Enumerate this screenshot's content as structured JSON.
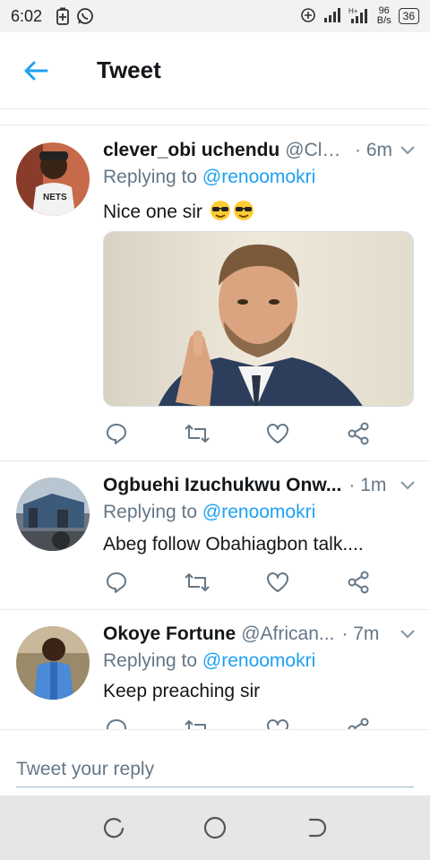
{
  "status_bar": {
    "time": "6:02",
    "network_speed_value": "96",
    "network_speed_unit": "B/s",
    "battery": "36"
  },
  "header": {
    "title": "Tweet"
  },
  "tweets": [
    {
      "name": "clever_obi uchendu",
      "handle": "@Cle...",
      "time": "· 6m",
      "replying_prefix": "Replying to ",
      "replying_to": "@renoomokri",
      "text": "Nice one sir",
      "emojis": [
        "sunglasses-emoji",
        "sunglasses-emoji"
      ]
    },
    {
      "name": "Ogbuehi Izuchukwu Onw...",
      "handle": "",
      "time": "· 1m",
      "replying_prefix": "Replying to ",
      "replying_to": "@renoomokri",
      "text": "Abeg follow Obahiagbon talk...."
    },
    {
      "name": "Okoye Fortune",
      "handle": "@African...",
      "time": "· 7m",
      "replying_prefix": "Replying to ",
      "replying_to": "@renoomokri",
      "text": "Keep preaching sir"
    }
  ],
  "reply_bar": {
    "placeholder": "Tweet your reply"
  },
  "colors": {
    "accent": "#1da1f2",
    "secondary_text": "#657786",
    "primary_text": "#14171a",
    "divider": "#e6ecf0"
  },
  "icons": {
    "back": "arrow-left-icon",
    "caret": "chevron-down-icon",
    "reply": "reply-icon",
    "retweet": "retweet-icon",
    "like": "heart-icon",
    "share": "share-icon"
  }
}
